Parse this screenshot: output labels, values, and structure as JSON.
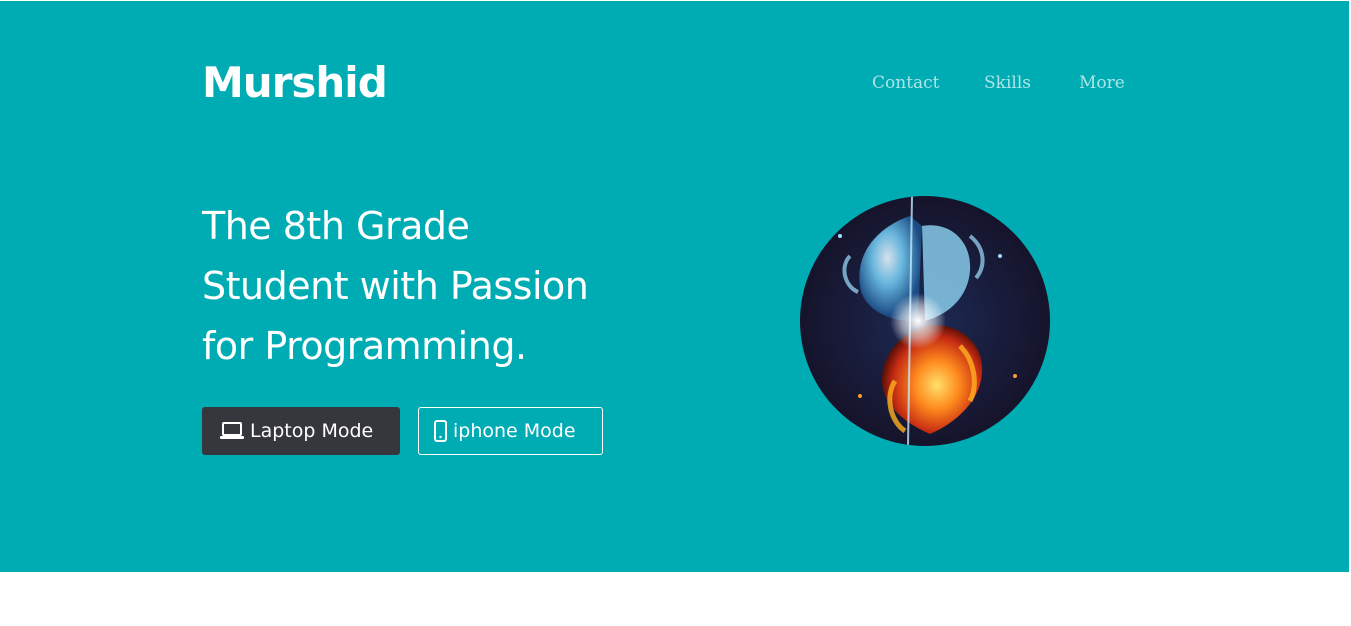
{
  "brand": {
    "name": "Murshid"
  },
  "nav": {
    "items": [
      {
        "label": "Contact"
      },
      {
        "label": "Skills"
      },
      {
        "label": "More"
      }
    ]
  },
  "hero": {
    "headline_lines": [
      "The 8th Grade",
      "Student with Passion",
      "for Programming."
    ],
    "buttons": {
      "laptop": {
        "label": "Laptop Mode",
        "icon": "laptop-icon"
      },
      "iphone": {
        "label": "iphone Mode",
        "icon": "phone-icon"
      }
    },
    "avatar": {
      "description_icon": "fire-and-ice-heart-image"
    }
  },
  "colors": {
    "hero_background": "#00acb4",
    "nav_text": "#aee4e6",
    "primary_button": "#36373c",
    "text": "#ffffff"
  }
}
